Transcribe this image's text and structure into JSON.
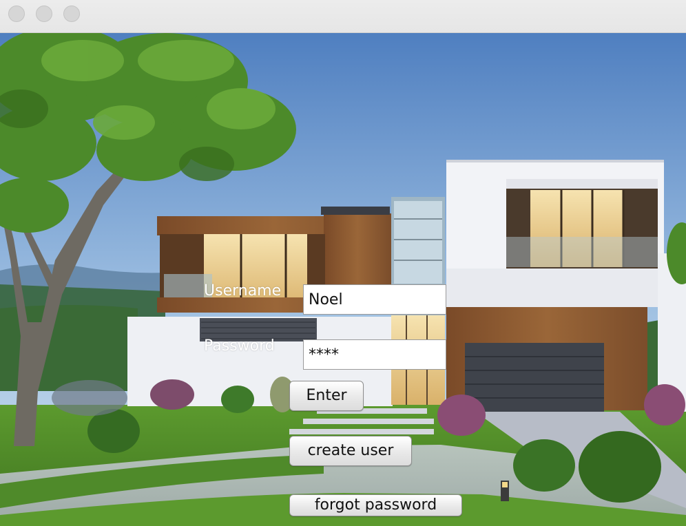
{
  "window": {
    "title": ""
  },
  "login": {
    "username_label": "Username",
    "username_value": "Noel",
    "password_label": "Password",
    "password_value": "****",
    "enter_label": "Enter",
    "create_user_label": "create user",
    "forgot_password_label": "forgot password"
  },
  "colors": {
    "sky_top": "#4f7fc0",
    "sky_bottom": "#b9d3ea",
    "lawn": "#4f8a2a",
    "wood": "#8a5a34",
    "house_white": "#f0f1f5"
  }
}
